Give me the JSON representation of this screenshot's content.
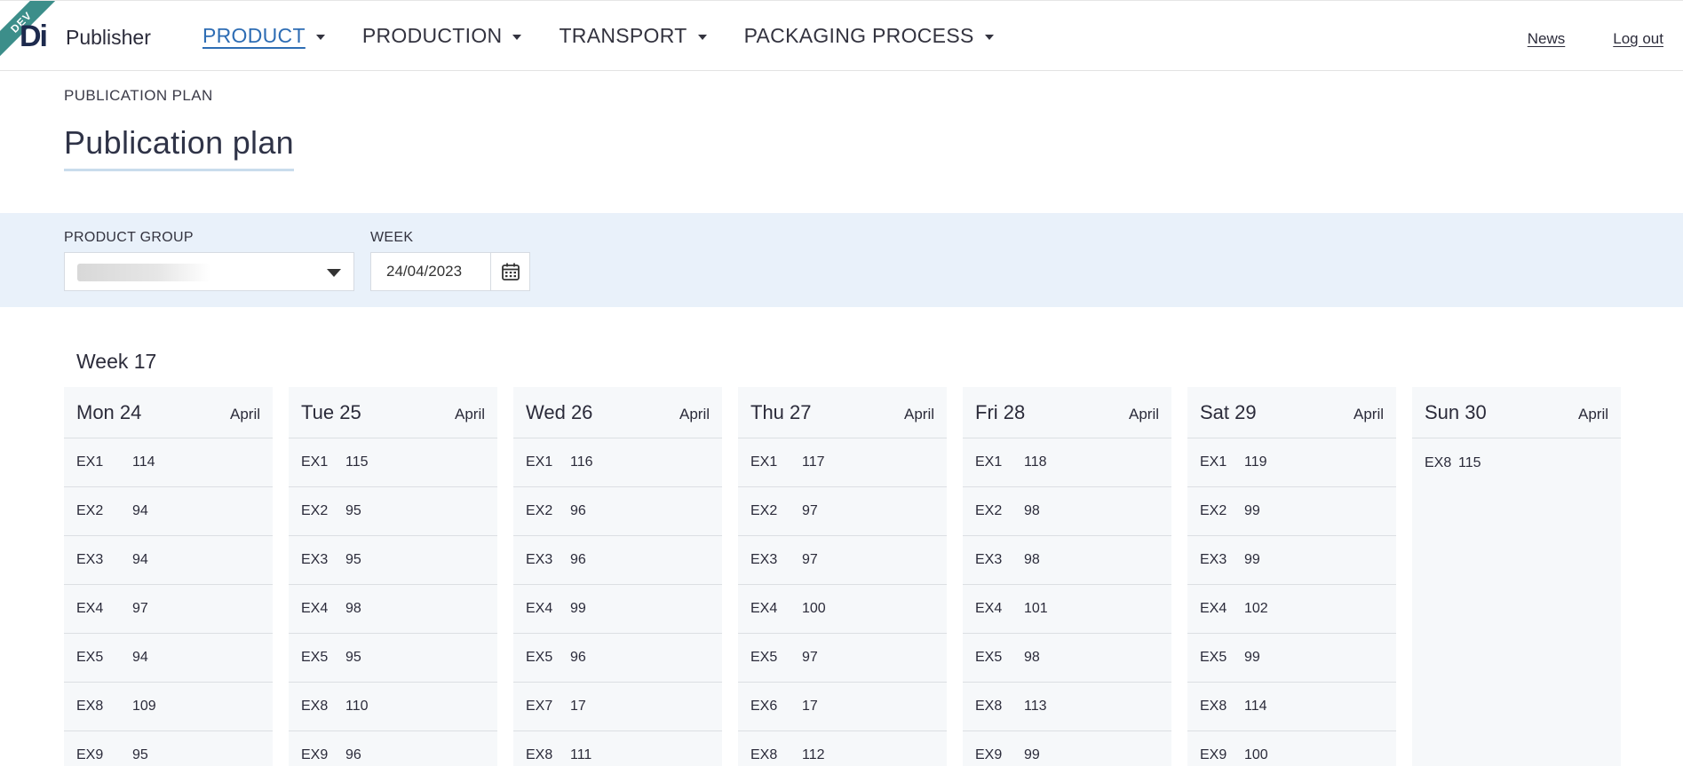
{
  "app": {
    "env_badge": "DEV",
    "logo_text": "Di",
    "name": "Publisher"
  },
  "nav": [
    {
      "label": "PRODUCT",
      "active": true
    },
    {
      "label": "PRODUCTION",
      "active": false
    },
    {
      "label": "TRANSPORT",
      "active": false
    },
    {
      "label": "PACKAGING PROCESS",
      "active": false
    }
  ],
  "header_links": {
    "news": "News",
    "logout": "Log out"
  },
  "breadcrumb": "PUBLICATION PLAN",
  "page_title": "Publication plan",
  "filters": {
    "product_group_label": "PRODUCT GROUP",
    "product_group_value": "",
    "week_label": "WEEK",
    "week_value": "24/04/2023"
  },
  "week": {
    "title": "Week 17",
    "days": [
      {
        "name": "Mon 24",
        "month": "April",
        "rows": [
          [
            "EX1",
            "114"
          ],
          [
            "EX2",
            "94"
          ],
          [
            "EX3",
            "94"
          ],
          [
            "EX4",
            "97"
          ],
          [
            "EX5",
            "94"
          ],
          [
            "EX8",
            "109"
          ],
          [
            "EX9",
            "95"
          ]
        ]
      },
      {
        "name": "Tue 25",
        "month": "April",
        "rows": [
          [
            "EX1",
            "115"
          ],
          [
            "EX2",
            "95"
          ],
          [
            "EX3",
            "95"
          ],
          [
            "EX4",
            "98"
          ],
          [
            "EX5",
            "95"
          ],
          [
            "EX8",
            "110"
          ],
          [
            "EX9",
            "96"
          ]
        ]
      },
      {
        "name": "Wed 26",
        "month": "April",
        "rows": [
          [
            "EX1",
            "116"
          ],
          [
            "EX2",
            "96"
          ],
          [
            "EX3",
            "96"
          ],
          [
            "EX4",
            "99"
          ],
          [
            "EX5",
            "96"
          ],
          [
            "EX7",
            "17"
          ],
          [
            "EX8",
            "111"
          ]
        ]
      },
      {
        "name": "Thu 27",
        "month": "April",
        "rows": [
          [
            "EX1",
            "117"
          ],
          [
            "EX2",
            "97"
          ],
          [
            "EX3",
            "97"
          ],
          [
            "EX4",
            "100"
          ],
          [
            "EX5",
            "97"
          ],
          [
            "EX6",
            "17"
          ],
          [
            "EX8",
            "112"
          ]
        ]
      },
      {
        "name": "Fri 28",
        "month": "April",
        "rows": [
          [
            "EX1",
            "118"
          ],
          [
            "EX2",
            "98"
          ],
          [
            "EX3",
            "98"
          ],
          [
            "EX4",
            "101"
          ],
          [
            "EX5",
            "98"
          ],
          [
            "EX8",
            "113"
          ],
          [
            "EX9",
            "99"
          ]
        ]
      },
      {
        "name": "Sat 29",
        "month": "April",
        "rows": [
          [
            "EX1",
            "119"
          ],
          [
            "EX2",
            "99"
          ],
          [
            "EX3",
            "99"
          ],
          [
            "EX4",
            "102"
          ],
          [
            "EX5",
            "99"
          ],
          [
            "EX8",
            "114"
          ],
          [
            "EX9",
            "100"
          ]
        ]
      },
      {
        "name": "Sun 30",
        "month": "April",
        "rows": [
          [
            "EX8",
            "115"
          ]
        ]
      }
    ]
  },
  "icons": {
    "calendar": "calendar-icon",
    "dropdown": "chevron-down-icon"
  },
  "colors": {
    "accent": "#2e6db4",
    "dev_ribbon": "#3c8e8a",
    "filter_bar_bg": "#e9f1fa",
    "day_column_bg": "#f6f8fa"
  }
}
